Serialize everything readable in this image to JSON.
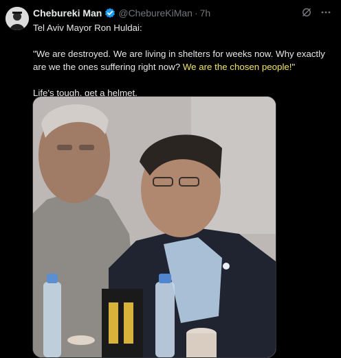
{
  "author": {
    "name": "Chebureki Man",
    "handle": "@ChebureKiMan",
    "separator": "·",
    "time": "7h"
  },
  "tweet": {
    "line1": "Tel Aviv Mayor Ron Huldai:",
    "quote_main": "\"We are destroyed. We are living in shelters for weeks now. Why exactly are we the ones suffering right now? ",
    "quote_highlight": "We are the chosen people!",
    "quote_end": "\"",
    "line3": "Life's tough, get a helmet."
  },
  "icons": {
    "verified": "verified-badge-icon",
    "grok": "grok-icon",
    "more": "more-icon"
  },
  "colors": {
    "background": "#000000",
    "text": "#e7e9ea",
    "muted": "#71767b",
    "highlight": "#f5e66a",
    "verified": "#1d9bf0"
  }
}
